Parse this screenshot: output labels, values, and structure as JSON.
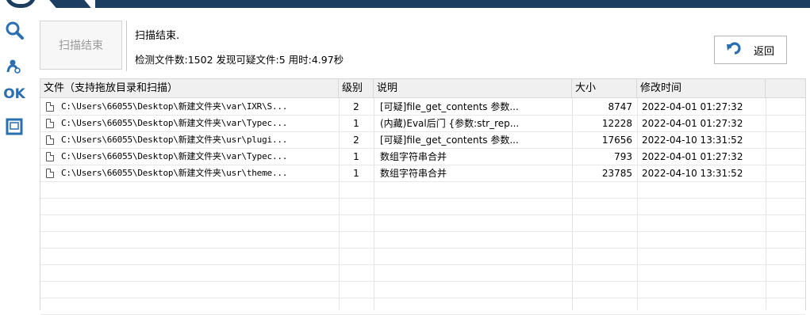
{
  "toolbar": {
    "icons": [
      "search-icon",
      "user-scan-icon",
      "ok-icon",
      "window-icon"
    ],
    "ok_label": "OK"
  },
  "header": {
    "stop_button_label": "扫描结束",
    "status_title": "扫描结束.",
    "status_detail": "检测文件数:1502 发现可疑文件:5 用时:4.97秒",
    "back_button_label": "返回"
  },
  "table": {
    "columns": [
      "文件（支持拖放目录和扫描）",
      "级别",
      "说明",
      "大小",
      "修改时间"
    ],
    "rows": [
      {
        "file": "C:\\Users\\66055\\Desktop\\新建文件夹\\var\\IXR\\S...",
        "level": "2",
        "desc": "[可疑]file_get_contents 参数...",
        "size": "8747",
        "mtime": "2022-04-01 01:27:32"
      },
      {
        "file": "C:\\Users\\66055\\Desktop\\新建文件夹\\var\\Typec...",
        "level": "1",
        "desc": "(内藏)Eval后门 {参数:str_rep...",
        "size": "12228",
        "mtime": "2022-04-01 01:27:32"
      },
      {
        "file": "C:\\Users\\66055\\Desktop\\新建文件夹\\usr\\plugi...",
        "level": "2",
        "desc": "[可疑]file_get_contents 参数...",
        "size": "17656",
        "mtime": "2022-04-10 13:31:52"
      },
      {
        "file": "C:\\Users\\66055\\Desktop\\新建文件夹\\var\\Typec...",
        "level": "1",
        "desc": "数组字符串合并",
        "size": "793",
        "mtime": "2022-04-01 01:27:32"
      },
      {
        "file": "C:\\Users\\66055\\Desktop\\新建文件夹\\usr\\theme...",
        "level": "1",
        "desc": "数组字符串合并",
        "size": "23785",
        "mtime": "2022-04-10 13:31:52"
      }
    ]
  },
  "colors": {
    "banner": "#1c3f61",
    "accent": "#2a6fb0",
    "header_bg": "#f0f0f0"
  }
}
